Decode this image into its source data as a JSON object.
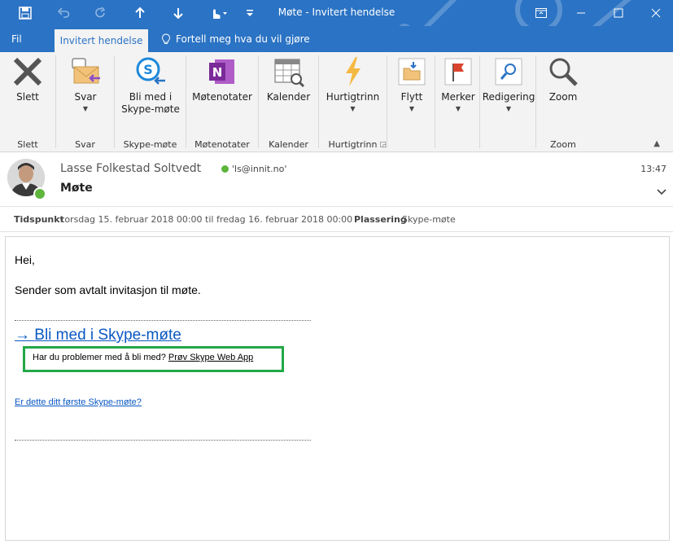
{
  "window": {
    "title": "Møte  -  Invitert hendelse"
  },
  "tabs": {
    "file": "Fil",
    "active": "Invitert hendelse",
    "tell_me": "Fortell meg hva du vil gjøre"
  },
  "ribbon": {
    "groups": {
      "delete": "Slett",
      "respond": "Svar",
      "skype": "Skype-møte",
      "notes": "Møtenotater",
      "calendar": "Kalender",
      "quicksteps": "Hurtigtrinn",
      "zoom": "Zoom"
    },
    "buttons": {
      "delete": "Slett",
      "respond": "Svar",
      "join_line1": "Bli med i",
      "join_line2": "Skype-møte",
      "notes": "Møtenotater",
      "calendar": "Kalender",
      "quicksteps": "Hurtigtrinn",
      "move": "Flytt",
      "tags": "Merker",
      "editing": "Redigering",
      "zoom": "Zoom"
    }
  },
  "message": {
    "sender": "Lasse Folkestad Soltvedt",
    "email": "'ls@innit.no'",
    "subject": "Møte",
    "time": "13:47",
    "when_label": "Tidspunkt",
    "when_value": "torsdag 15. februar 2018 00:00 til fredag 16. februar 2018 00:00",
    "location_label": "Plassering",
    "location_value": "Skype-møte"
  },
  "body": {
    "greeting": "Hei,",
    "text": "Sender som avtalt invitasjon til møte.",
    "join_link": "Bli med i Skype-møte",
    "trouble_text": "Har du problemer med å bli med?",
    "trouble_link": "Prøv Skype Web App",
    "first_link": "Er dette ditt første Skype-møte?"
  },
  "colors": {
    "accent": "#2b73c4",
    "highlight_box": "#23a847",
    "link": "#0a58c2"
  }
}
